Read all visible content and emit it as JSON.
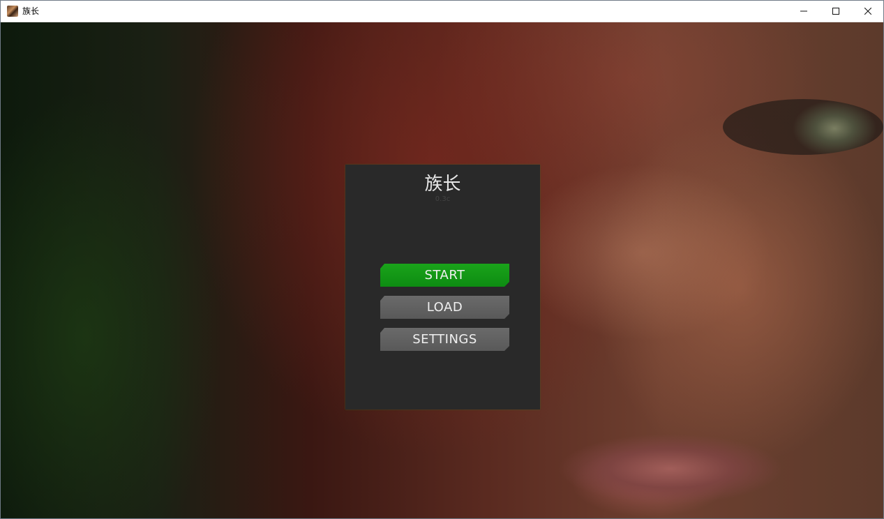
{
  "window": {
    "title": "族长",
    "icon": "game-app-icon",
    "controls": {
      "minimize": "minimize-icon",
      "maximize": "maximize-icon",
      "close": "close-icon"
    }
  },
  "menu": {
    "title": "族长",
    "version": "0.3c",
    "buttons": {
      "start": "START",
      "load": "LOAD",
      "settings": "SETTINGS"
    },
    "colors": {
      "panel": "#292929",
      "start_button": "#12961a",
      "default_button": "#626262"
    }
  }
}
